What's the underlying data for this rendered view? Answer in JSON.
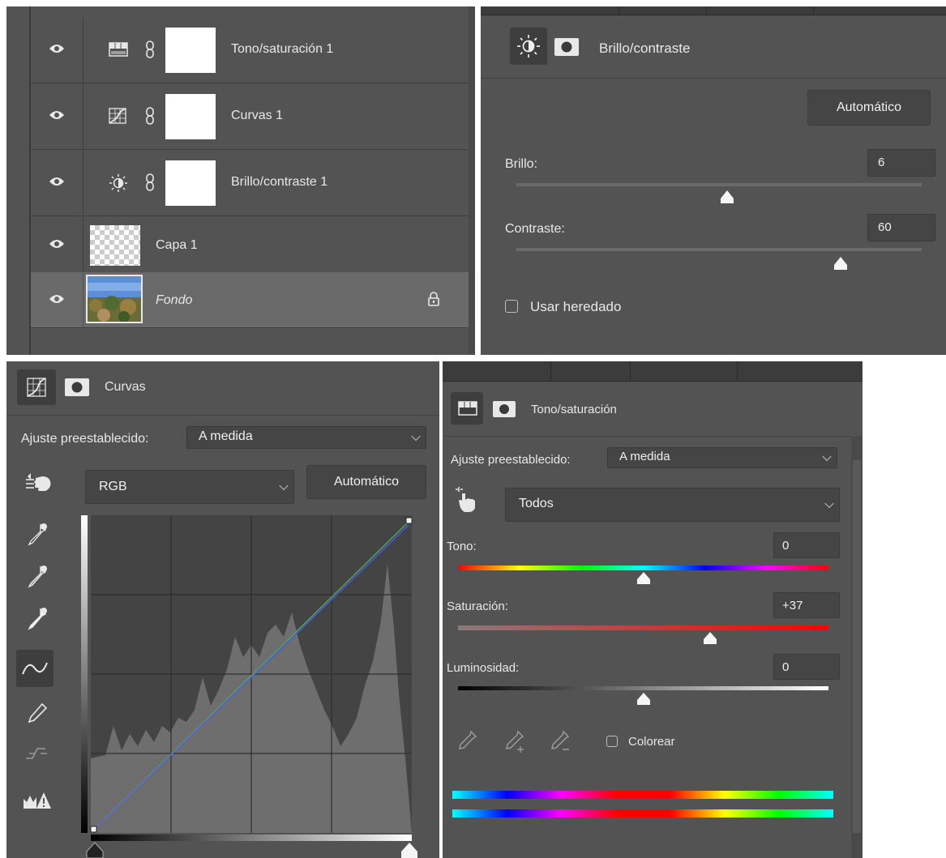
{
  "layers": {
    "items": [
      {
        "name": "Tono/saturación 1",
        "type": "hue-saturation"
      },
      {
        "name": "Curvas 1",
        "type": "curves"
      },
      {
        "name": "Brillo/contraste 1",
        "type": "brightness-contrast"
      },
      {
        "name": "Capa 1",
        "type": "pixel"
      },
      {
        "name": "Fondo",
        "type": "background",
        "locked": true
      }
    ],
    "icons": {
      "visibility": "eye-icon",
      "link": "chain-link-icon",
      "lock": "lock-icon"
    }
  },
  "brightness_contrast": {
    "title": "Brillo/contraste",
    "auto_label": "Automático",
    "brightness_label": "Brillo:",
    "brightness_value": "6",
    "brightness_fraction": 0.52,
    "contrast_label": "Contraste:",
    "contrast_value": "60",
    "contrast_fraction": 0.8,
    "legacy_label": "Usar heredado",
    "legacy_checked": false
  },
  "curves": {
    "title": "Curvas",
    "preset_label": "Ajuste preestablecido:",
    "preset_value": "A medida",
    "channel_value": "RGB",
    "auto_label": "Automático",
    "tools": [
      "hand-target-icon",
      "black-eyedropper-icon",
      "gray-eyedropper-icon",
      "white-eyedropper-icon",
      "curve-point-icon",
      "pencil-icon",
      "smooth-icon",
      "clipping-warning-icon"
    ]
  },
  "hue_saturation": {
    "title": "Tono/saturación",
    "preset_label": "Ajuste preestablecido:",
    "preset_value": "A medida",
    "range_value": "Todos",
    "hue_label": "Tono:",
    "hue_value": "0",
    "hue_fraction": 0.5,
    "saturation_label": "Saturación:",
    "saturation_value": "+37",
    "saturation_fraction": 0.68,
    "lightness_label": "Luminosidad:",
    "lightness_value": "0",
    "lightness_fraction": 0.5,
    "colorize_label": "Colorear",
    "colorize_checked": false
  },
  "colors": {
    "panel_bg": "#535353",
    "field_bg": "#454545",
    "highlight": "#666666",
    "divider": "#3e3e3e"
  }
}
